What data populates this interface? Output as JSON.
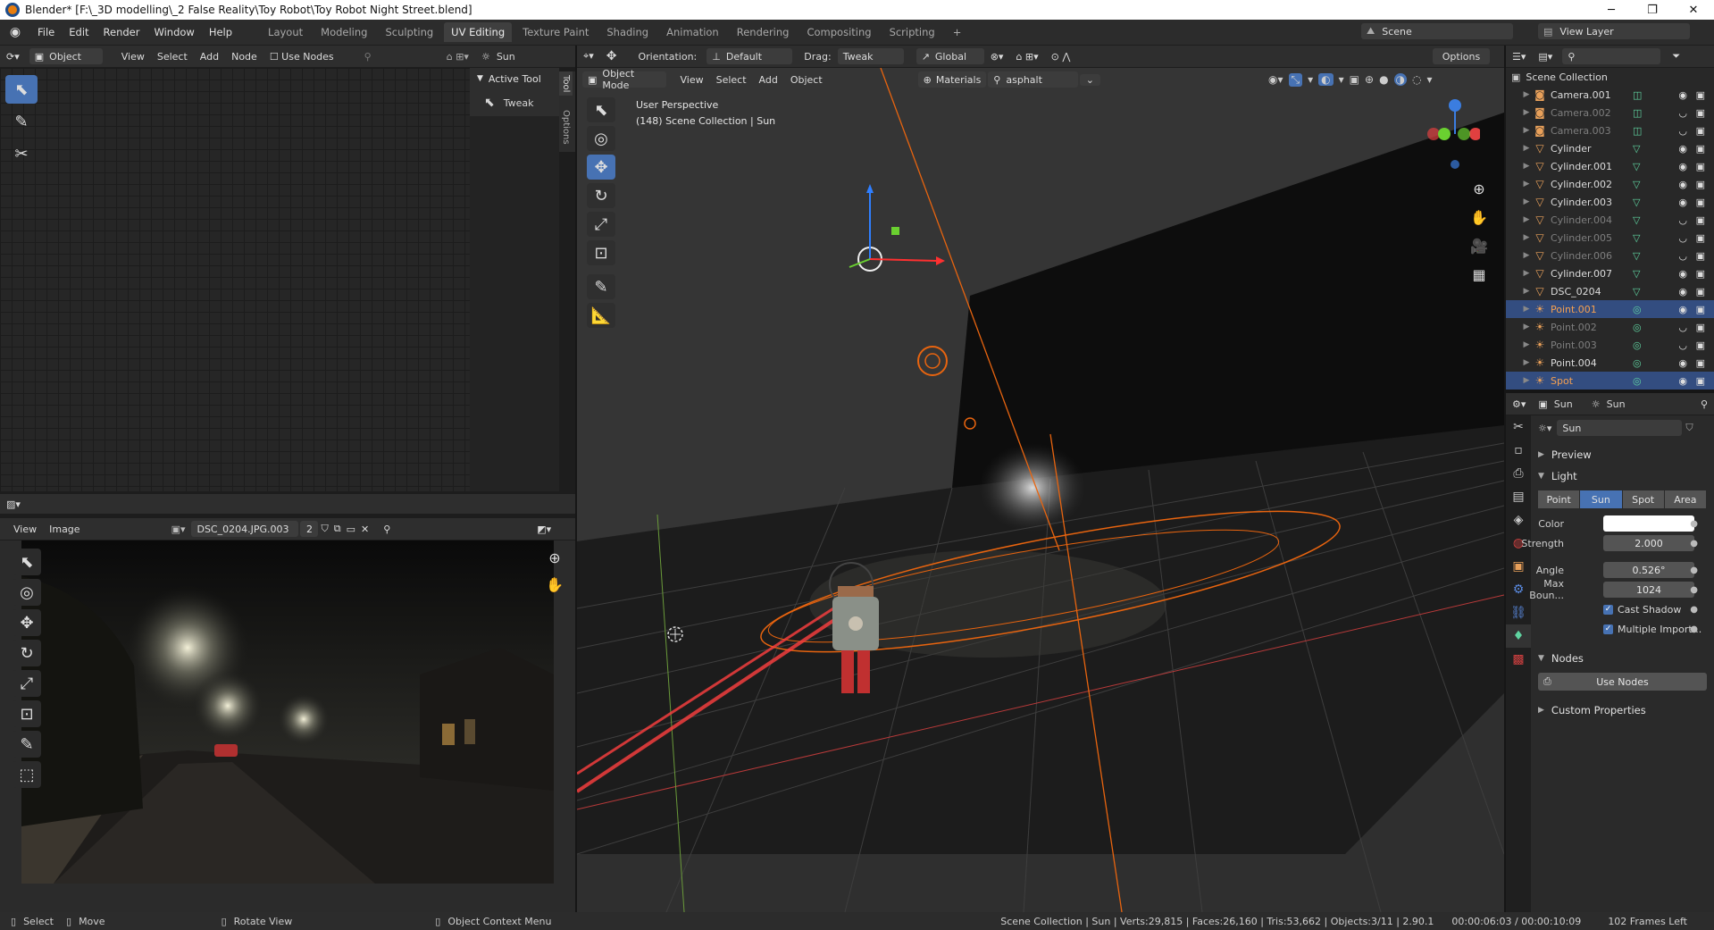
{
  "window": {
    "title": "Blender* [F:\\_3D modelling\\_2 False Reality\\Toy Robot\\Toy Robot Night Street.blend]",
    "minimize": "─",
    "maximize": "❐",
    "close": "✕"
  },
  "topbar": {
    "menus": [
      "File",
      "Edit",
      "Render",
      "Window",
      "Help"
    ],
    "workspaces": [
      "Layout",
      "Modeling",
      "Sculpting",
      "UV Editing",
      "Texture Paint",
      "Shading",
      "Animation",
      "Rendering",
      "Compositing",
      "Scripting"
    ],
    "active_workspace": "UV Editing",
    "add_tab": "+",
    "scene": "Scene",
    "view_layer": "View Layer"
  },
  "node_editor": {
    "type": "Object",
    "menus": [
      "View",
      "Select",
      "Add",
      "Node"
    ],
    "use_nodes": "Use Nodes",
    "sun": "Sun",
    "sidebar_title": "Active Tool",
    "tool_name": "Tweak",
    "side_tabs": [
      "Tool",
      "Options"
    ]
  },
  "image_editor": {
    "menus": [
      "View",
      "Image"
    ],
    "image_name": "DSC_0204.JPG.003",
    "users": "2"
  },
  "viewport": {
    "header1": {
      "orientation_label": "Orientation:",
      "orientation": "Default",
      "drag_label": "Drag:",
      "drag": "Tweak",
      "transform": "Global",
      "options": "Options"
    },
    "header2": {
      "mode": "Object Mode",
      "menus": [
        "View",
        "Select",
        "Add",
        "Object"
      ],
      "materials": "Materials",
      "search": "asphalt"
    },
    "overlay_line1": "User Perspective",
    "overlay_line2": "(148) Scene Collection | Sun"
  },
  "outliner": {
    "root": "Scene Collection",
    "items": [
      {
        "name": "Camera.001",
        "icon": "camera-icon",
        "dim": false,
        "sel": false
      },
      {
        "name": "Camera.002",
        "icon": "camera-icon",
        "dim": true,
        "sel": false
      },
      {
        "name": "Camera.003",
        "icon": "camera-icon",
        "dim": true,
        "sel": false
      },
      {
        "name": "Cylinder",
        "icon": "mesh-icon",
        "dim": false,
        "sel": false
      },
      {
        "name": "Cylinder.001",
        "icon": "mesh-icon",
        "dim": false,
        "sel": false
      },
      {
        "name": "Cylinder.002",
        "icon": "mesh-icon",
        "dim": false,
        "sel": false
      },
      {
        "name": "Cylinder.003",
        "icon": "mesh-icon",
        "dim": false,
        "sel": false
      },
      {
        "name": "Cylinder.004",
        "icon": "mesh-icon",
        "dim": true,
        "sel": false
      },
      {
        "name": "Cylinder.005",
        "icon": "mesh-icon",
        "dim": true,
        "sel": false
      },
      {
        "name": "Cylinder.006",
        "icon": "mesh-icon",
        "dim": true,
        "sel": false
      },
      {
        "name": "Cylinder.007",
        "icon": "mesh-icon",
        "dim": false,
        "sel": false
      },
      {
        "name": "DSC_0204",
        "icon": "mesh-icon",
        "dim": false,
        "sel": false
      },
      {
        "name": "Point.001",
        "icon": "light-icon",
        "dim": false,
        "sel": true
      },
      {
        "name": "Point.002",
        "icon": "light-icon",
        "dim": true,
        "sel": false
      },
      {
        "name": "Point.003",
        "icon": "light-icon",
        "dim": true,
        "sel": false
      },
      {
        "name": "Point.004",
        "icon": "light-icon",
        "dim": false,
        "sel": false
      },
      {
        "name": "Spot",
        "icon": "light-icon",
        "dim": false,
        "sel": true
      }
    ]
  },
  "properties": {
    "breadcrumb_object": "Sun",
    "breadcrumb_data": "Sun",
    "data_name": "Sun",
    "preview": "Preview",
    "light": "Light",
    "light_types": [
      "Point",
      "Sun",
      "Spot",
      "Area"
    ],
    "active_type": "Sun",
    "color_label": "Color",
    "strength_label": "Strength",
    "strength": "2.000",
    "angle_label": "Angle",
    "angle": "0.526°",
    "max_bounces_label": "Max Boun...",
    "max_bounces": "1024",
    "cast_shadow": "Cast Shadow",
    "multiple_importance": "Multiple Import...",
    "nodes": "Nodes",
    "use_nodes": "Use Nodes",
    "custom_properties": "Custom Properties"
  },
  "statusbar": {
    "select": "Select",
    "move": "Move",
    "rotate": "Rotate View",
    "context": "Object Context Menu",
    "stats": "Scene Collection | Sun | Verts:29,815 | Faces:26,160 | Tris:53,662 | Objects:3/11 | 2.90.1",
    "time": "00:00:06:03 / 00:00:10:09",
    "frames": "102 Frames Left"
  },
  "colors": {
    "accent": "#4772b3",
    "selected_row": "#334d80",
    "orange": "#e8640f"
  }
}
